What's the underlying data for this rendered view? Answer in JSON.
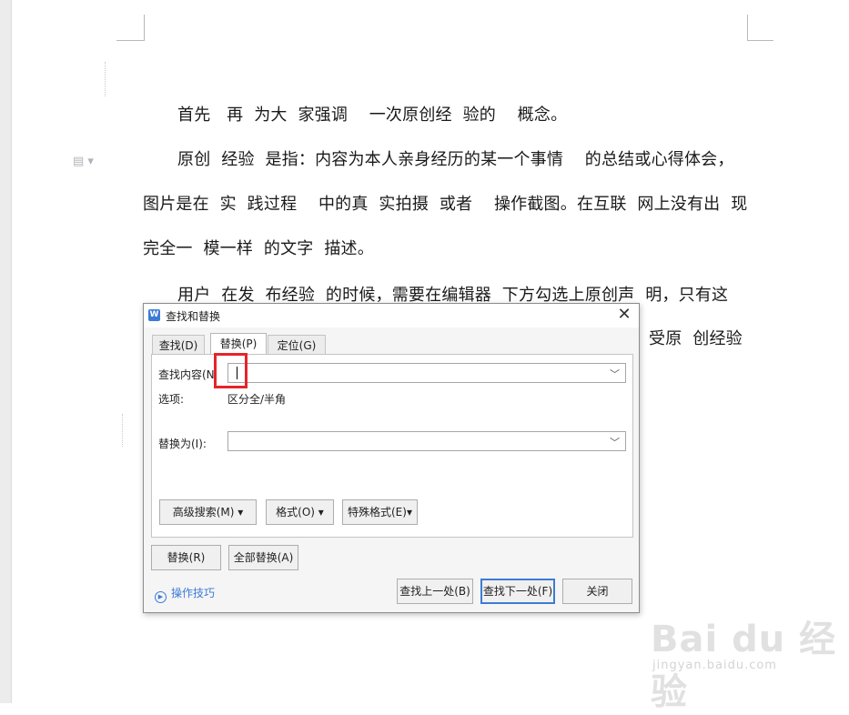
{
  "document": {
    "paragraphs": [
      "首先   再  为大  家强调    一次原创经  验的    概念。",
      "原创  经验  是指：内容为本人亲身经历的某一个事情    的总结或心得体会，",
      "图片是在  实  践过程    中的真  实拍摄  或者    操作截图。在互联  网上没有出  现",
      "完全一  模一样  的文字  描述。",
      "用户  在发  布经验  的时候，需要在编辑器  下方勾选上原创声  明，只有这",
      "受原  创经验"
    ]
  },
  "dialog": {
    "title": "查找和替换",
    "app_icon": "W",
    "close_glyph": "✕",
    "tabs": [
      "查找(D)",
      "替换(P)",
      "定位(G)"
    ],
    "active_tab": "替换(P)",
    "find_label": "查找内容(N",
    "find_value": "",
    "options_label": "选项:",
    "options_value": "区分全/半角",
    "replace_label": "替换为(I):",
    "replace_value": "",
    "advanced_search": "高级搜索(M)  ▾",
    "format": "格式(O)  ▾",
    "special_format": "特殊格式(E)▾",
    "replace_button": "替换(R)",
    "replace_all_button": "全部替换(A)",
    "tips_link": "操作技巧",
    "find_prev": "查找上一处(B)",
    "find_next": "查找下一处(F)",
    "close_button": "关闭"
  },
  "icons": {
    "doc_icon": "document-icon",
    "chevron": "chevron-down-icon"
  },
  "watermark": {
    "brand": "Bai du 经验",
    "url": "jingyan.baidu.com"
  }
}
